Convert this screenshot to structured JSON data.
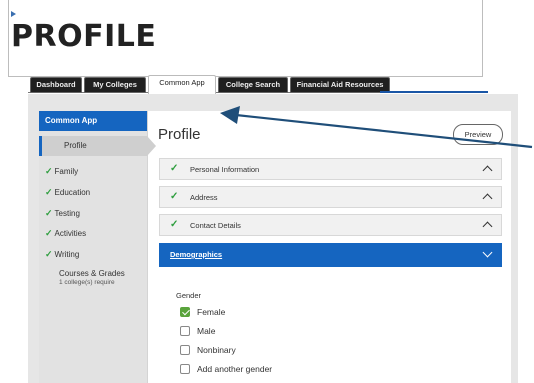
{
  "slide": {
    "title": "PROFILE"
  },
  "tabs": [
    {
      "label": "Dashboard"
    },
    {
      "label": "My Colleges"
    },
    {
      "label": "Common App"
    },
    {
      "label": "College Search"
    },
    {
      "label": "Financial Aid Resources"
    }
  ],
  "sidebar": {
    "header": "Common App",
    "items": [
      {
        "label": "Profile"
      },
      {
        "label": "Family",
        "complete": true
      },
      {
        "label": "Education",
        "complete": true
      },
      {
        "label": "Testing",
        "complete": true
      },
      {
        "label": "Activities",
        "complete": true
      },
      {
        "label": "Writing",
        "complete": true
      },
      {
        "label": "Courses & Grades",
        "note": "1 college(s) require"
      }
    ]
  },
  "main": {
    "title": "Profile",
    "preview_label": "Preview",
    "sections": [
      {
        "label": "Personal Information",
        "complete": true
      },
      {
        "label": "Address",
        "complete": true
      },
      {
        "label": "Contact Details",
        "complete": true
      },
      {
        "label": "Demographics",
        "expanded": true
      }
    ],
    "gender": {
      "label": "Gender",
      "options": [
        {
          "label": "Female",
          "checked": true
        },
        {
          "label": "Male",
          "checked": false
        },
        {
          "label": "Nonbinary",
          "checked": false
        },
        {
          "label": "Add another gender",
          "checked": false
        }
      ]
    }
  },
  "colors": {
    "accent": "#1565c0",
    "check": "#2e9e3e",
    "arrow": "#1f4e79"
  }
}
